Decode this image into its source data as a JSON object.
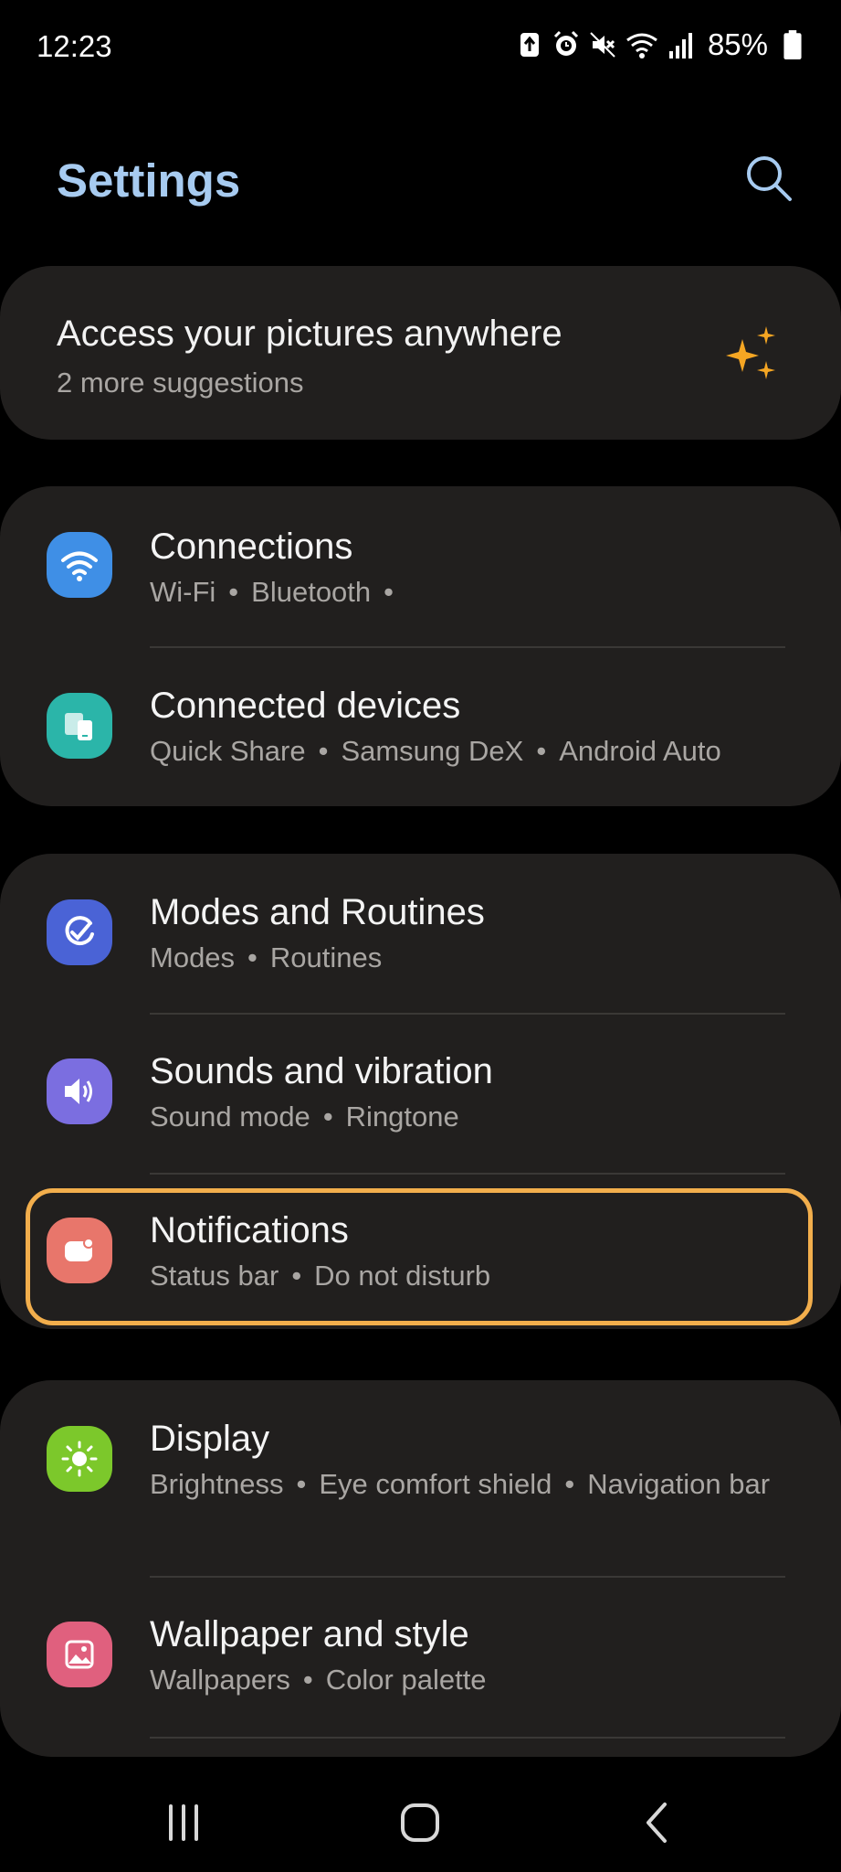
{
  "status_bar": {
    "time": "12:23",
    "battery_percent": "85%",
    "icons": [
      "battery-saver-icon",
      "alarm-icon",
      "mute-icon",
      "wifi-icon",
      "signal-icon",
      "battery-icon"
    ]
  },
  "header": {
    "title": "Settings",
    "search_icon": "search-icon"
  },
  "suggestion": {
    "title": "Access your pictures anywhere",
    "subtitle": "2 more suggestions",
    "icon": "sparkle-icon",
    "icon_color": "#f5a623"
  },
  "items": [
    {
      "title": "Connections",
      "subtitle": [
        "Wi-Fi",
        "Bluetooth",
        ""
      ],
      "icon": "wifi-icon",
      "color": "#3f8fe6"
    },
    {
      "title": "Connected devices",
      "subtitle": [
        "Quick Share",
        "Samsung DeX",
        "Android Auto"
      ],
      "icon": "devices-icon",
      "color": "#2bb5a9"
    },
    {
      "title": "Modes and Routines",
      "subtitle": [
        "Modes",
        "Routines"
      ],
      "icon": "routine-check-icon",
      "color": "#4a63d6"
    },
    {
      "title": "Sounds and vibration",
      "subtitle": [
        "Sound mode",
        "Ringtone"
      ],
      "icon": "speaker-icon",
      "color": "#7b6ee0"
    },
    {
      "title": "Notifications",
      "subtitle": [
        "Status bar",
        "Do not disturb"
      ],
      "icon": "notification-icon",
      "color": "#e8766b"
    },
    {
      "title": "Display",
      "subtitle": [
        "Brightness",
        "Eye comfort shield",
        "Navigation bar"
      ],
      "icon": "brightness-icon",
      "color": "#7cc82b"
    },
    {
      "title": "Wallpaper and style",
      "subtitle": [
        "Wallpapers",
        "Color palette"
      ],
      "icon": "wallpaper-icon",
      "color": "#e0607e"
    }
  ],
  "highlight": {
    "target": "Notifications",
    "color": "#f2ae4c"
  },
  "nav_bar": {
    "icons": [
      "recent-apps-icon",
      "home-icon",
      "back-icon"
    ]
  }
}
